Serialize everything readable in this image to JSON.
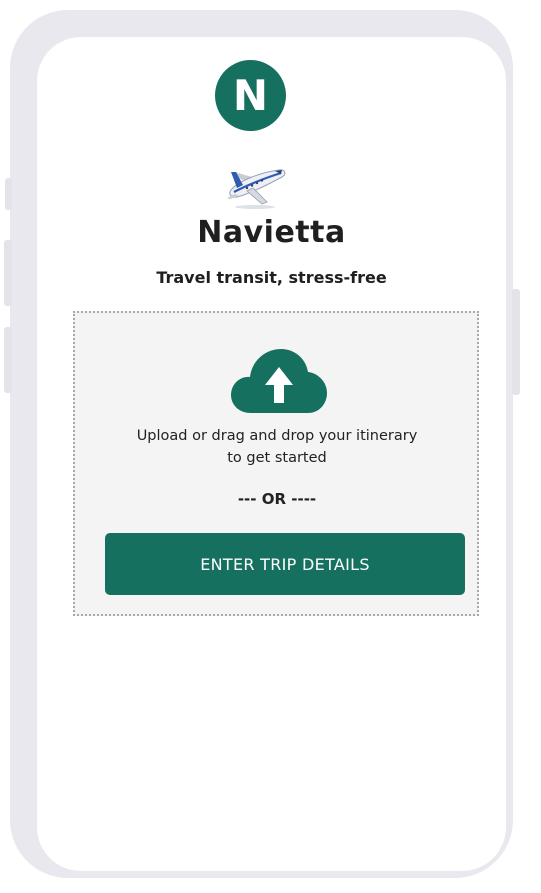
{
  "app": {
    "logo_letter": "N",
    "name": "Navietta",
    "tagline": "Travel transit, stress-free"
  },
  "upload": {
    "line1": "Upload or drag and drop your itinerary",
    "line2": "to get started",
    "divider": "--- OR ----"
  },
  "actions": {
    "enter_trip_label": "ENTER TRIP DETAILS"
  },
  "icons": {
    "plane": "airplane-icon",
    "upload": "cloud-upload-icon"
  },
  "colors": {
    "accent": "#16705f",
    "dropzone_bg": "#f4f4f4",
    "device_frame": "#e8e8ee"
  }
}
